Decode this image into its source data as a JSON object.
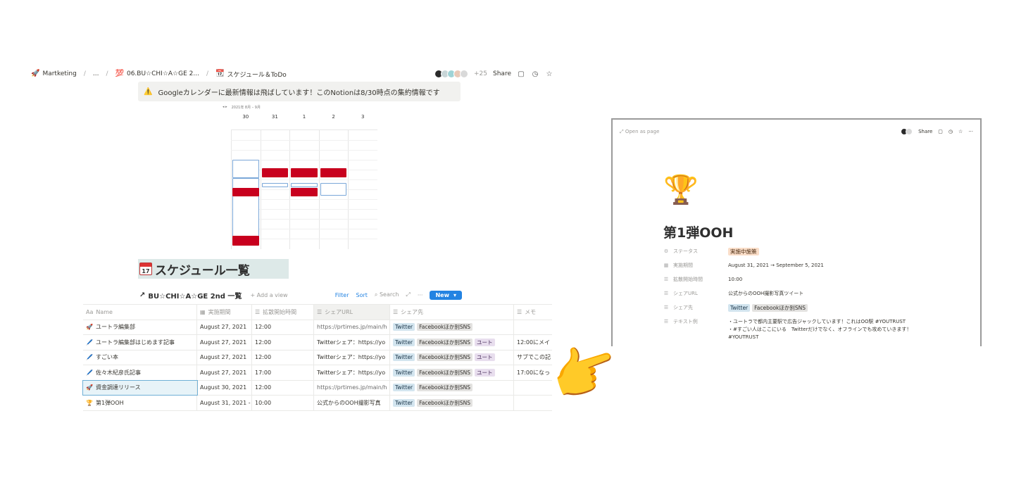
{
  "breadcrumb": {
    "items": [
      {
        "icon": "🚀",
        "label": "Martketing"
      },
      {
        "icon": "",
        "label": "..."
      },
      {
        "icon": "💯",
        "label": "06.BU☆CHI☆A☆GE 2..."
      },
      {
        "icon": "📆",
        "label": "スケジュール＆ToDo"
      }
    ],
    "sep": "/",
    "extra_count": "+25",
    "share": "Share"
  },
  "callout": {
    "icon": "⚠️",
    "text": "Googleカレンダーに最新情報は飛ばしています！このNotionは8/30時点の集約情報です"
  },
  "calendar": {
    "days": [
      "30",
      "31",
      "1",
      "2",
      "3"
    ],
    "header": "2021年 8月 – 9月"
  },
  "section_heading": {
    "text": "スケジュール一覧"
  },
  "database": {
    "title": "BU☆CHI☆A☆GE 2nd 一覧",
    "link_icon": "↗",
    "add_view": "+ Add a view",
    "filter": "Filter",
    "sort": "Sort",
    "search": "Search",
    "new": "New",
    "columns": [
      "Name",
      "実施期間",
      "拡散開始時間",
      "シェアURL",
      "シェア先",
      "メモ"
    ],
    "column_icons": [
      "Aa",
      "▦",
      "☰",
      "☰",
      "☰",
      "☰"
    ],
    "rows": [
      {
        "icon": "🚀",
        "name": "ユートラ編集部",
        "date": "August 27, 2021",
        "time": "12:00",
        "url": "https://prtimes.jp/main/h",
        "url_muted": true,
        "tags": [
          [
            "Twitter",
            "blue"
          ],
          [
            "Facebookほか別SNS",
            "gray"
          ]
        ],
        "memo": ""
      },
      {
        "icon": "🖊️",
        "name": "ユートラ編集部はじめます記事",
        "date": "August 27, 2021",
        "time": "12:00",
        "url": "Twitterシェア：https://yo",
        "url_muted": false,
        "tags": [
          [
            "Twitter",
            "blue"
          ],
          [
            "Facebookほか別SNS",
            "gray"
          ],
          [
            "ユート",
            "purple"
          ]
        ],
        "memo": "12:00にメイ"
      },
      {
        "icon": "🖊️",
        "name": "すごい本",
        "date": "August 27, 2021",
        "time": "12:00",
        "url": "Twitterシェア：https://yo",
        "url_muted": false,
        "tags": [
          [
            "Twitter",
            "blue"
          ],
          [
            "Facebookほか別SNS",
            "gray"
          ],
          [
            "ユート",
            "purple"
          ]
        ],
        "memo": "サブでこの記"
      },
      {
        "icon": "🖊️",
        "name": "佐々木紀彦氏記事",
        "date": "August 27, 2021",
        "time": "17:00",
        "url": "Twitterシェア：https://yo",
        "url_muted": false,
        "tags": [
          [
            "Twitter",
            "blue"
          ],
          [
            "Facebookほか別SNS",
            "gray"
          ],
          [
            "ユート",
            "purple"
          ]
        ],
        "memo": "17:00になっ"
      },
      {
        "icon": "🚀",
        "name": "資金調達リリース",
        "date": "August 30, 2021",
        "time": "12:00",
        "url": "https://prtimes.jp/main/h",
        "url_muted": true,
        "tags": [
          [
            "Twitter",
            "blue"
          ],
          [
            "Facebookほか別SNS",
            "gray"
          ]
        ],
        "memo": ""
      },
      {
        "icon": "🏆",
        "name": "第1弾OOH",
        "date": "August 31, 2021 -",
        "time": "10:00",
        "url": "公式からのOOH撮影写真",
        "url_muted": false,
        "tags": [
          [
            "Twitter",
            "blue"
          ],
          [
            "Facebookほか別SNS",
            "gray"
          ]
        ],
        "memo": ""
      }
    ]
  },
  "panel": {
    "open_as_page": "Open as page",
    "share": "Share",
    "icon": "🏆",
    "title": "第1弾OOH",
    "properties": [
      {
        "icon": "⚙",
        "label": "ステータス",
        "value": "実施中施策",
        "type": "tag"
      },
      {
        "icon": "▦",
        "label": "実施期間",
        "value": "August 31, 2021 → September 5, 2021",
        "type": "text"
      },
      {
        "icon": "☰",
        "label": "拡散開始時間",
        "value": "10:00",
        "type": "text"
      },
      {
        "icon": "☰",
        "label": "シェアURL",
        "value": "公式からのOOH撮影写真ツイート",
        "type": "text"
      },
      {
        "icon": "☰",
        "label": "シェア先",
        "value": "",
        "type": "tags",
        "tags": [
          "Twitter",
          "Facebookほか別SNS"
        ]
      },
      {
        "icon": "☰",
        "label": "テキスト例",
        "value": "・ユートラで都内主要駅で広告ジャックしています！これはOO駅 #YOUTRUST\n・#すごい人はここにいる　Twitterだけでなく、オフラインでも攻めていきます！\n#YOUTRUST",
        "type": "text"
      }
    ]
  },
  "hand_icon": "👉"
}
